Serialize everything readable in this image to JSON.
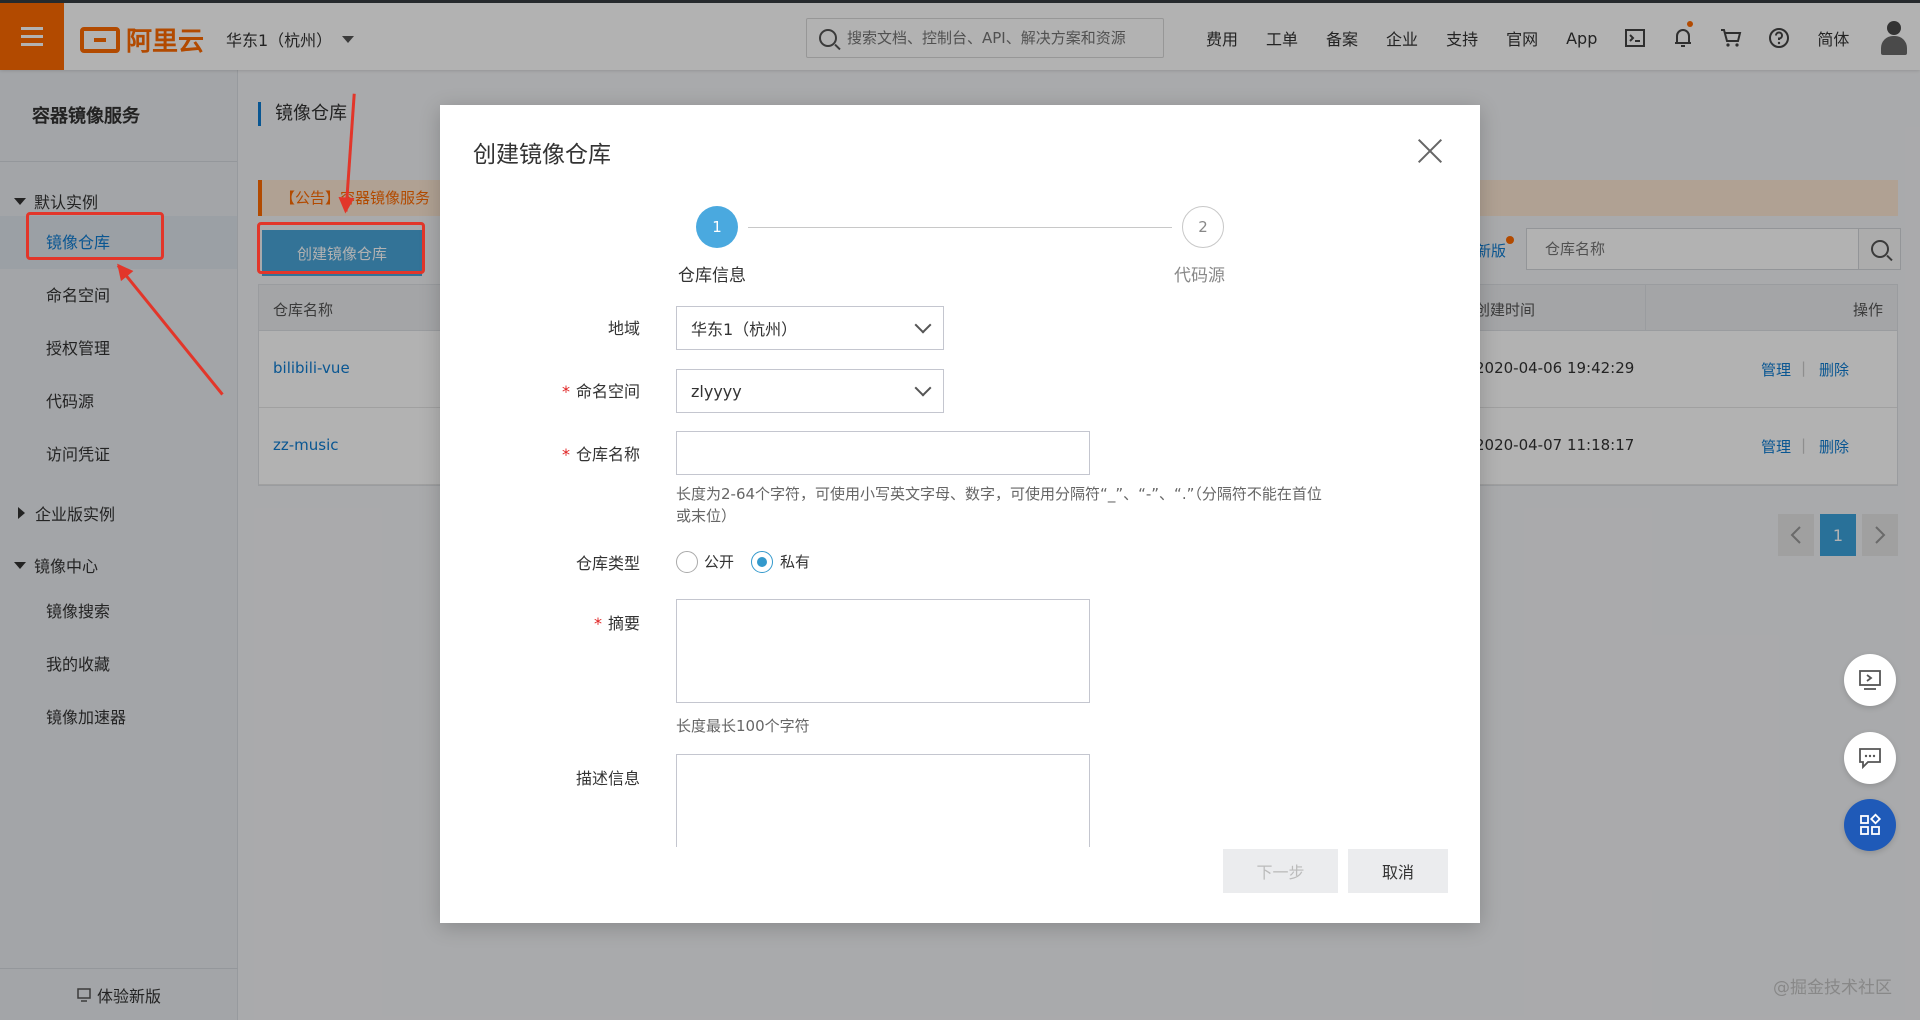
{
  "topbar": {
    "logo_text": "阿里云",
    "region": "华东1（杭州）",
    "search_placeholder": "搜索文档、控制台、API、解决方案和资源",
    "nav": [
      "费用",
      "工单",
      "备案",
      "企业",
      "支持",
      "官网",
      "App"
    ],
    "language": "简体"
  },
  "sidebar": {
    "title": "容器镜像服务",
    "group_default": "默认实例",
    "items_default": [
      "镜像仓库",
      "命名空间",
      "授权管理",
      "代码源",
      "访问凭证"
    ],
    "group_enterprise": "企业版实例",
    "group_center": "镜像中心",
    "items_center": [
      "镜像搜索",
      "我的收藏",
      "镜像加速器"
    ],
    "footer": "体验新版"
  },
  "main": {
    "title": "镜像仓库",
    "notice": "【公告】容器镜像服务",
    "create_button": "创建镜像仓库",
    "new_link": "新版",
    "search_placeholder": "仓库名称",
    "columns": {
      "name": "仓库名称",
      "created": "创建时间",
      "ops": "操作"
    },
    "rows": [
      {
        "name": "bilibili-vue",
        "created": "2020-04-06 19:42:29",
        "manage": "管理",
        "delete": "删除"
      },
      {
        "name": "zz-music",
        "created": "2020-04-07 11:18:17",
        "manage": "管理",
        "delete": "删除"
      }
    ],
    "page": "1"
  },
  "modal": {
    "title": "创建镜像仓库",
    "steps": [
      {
        "num": "1",
        "label": "仓库信息"
      },
      {
        "num": "2",
        "label": "代码源"
      }
    ],
    "fields": {
      "region_label": "地域",
      "region_value": "华东1（杭州）",
      "namespace_label": "命名空间",
      "namespace_value": "zlyyyy",
      "repo_name_label": "仓库名称",
      "repo_name_help_line1": "长度为2-64个字符，可使用小写英文字母、数字，可使用分隔符“_”、“-”、“.”（分隔符不能在首位",
      "repo_name_help_line2": "或末位）",
      "repo_type_label": "仓库类型",
      "repo_type_public": "公开",
      "repo_type_private": "私有",
      "summary_label": "摘要",
      "summary_help": "长度最长100个字符",
      "description_label": "描述信息"
    },
    "next_button": "下一步",
    "cancel_button": "取消"
  },
  "watermark": "@掘金技术社区",
  "colors": {
    "accent_orange": "#ff6a00",
    "primary_blue": "#0d7bd1",
    "step_active": "#4aa9df",
    "annotation_red": "#e2362a"
  }
}
